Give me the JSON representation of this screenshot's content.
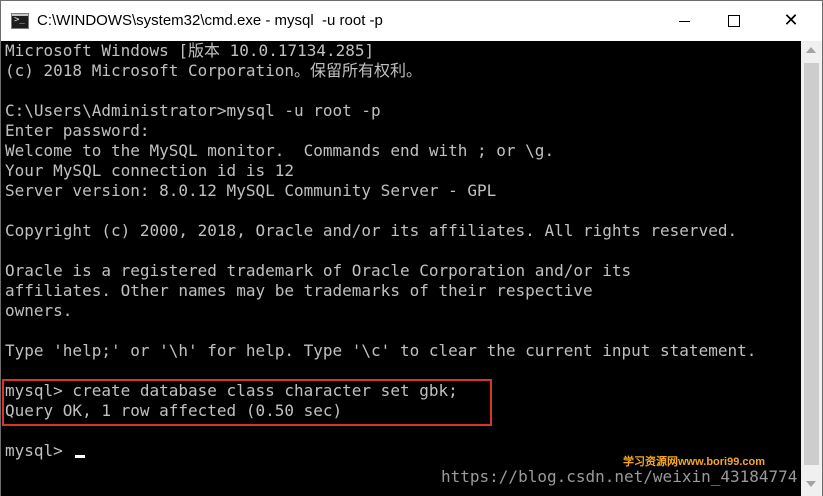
{
  "window": {
    "title": "C:\\WINDOWS\\system32\\cmd.exe - mysql  -u root -p"
  },
  "titlebar_icon": "cmd-icon",
  "controls": {
    "minimize_icon": "minimize-icon",
    "maximize_icon": "maximize-icon",
    "close_icon": "close-icon"
  },
  "console": {
    "lines": [
      "Microsoft Windows [版本 10.0.17134.285]",
      "(c) 2018 Microsoft Corporation。保留所有权利。",
      "",
      "C:\\Users\\Administrator>mysql -u root -p",
      "Enter password:",
      "Welcome to the MySQL monitor.  Commands end with ; or \\g.",
      "Your MySQL connection id is 12",
      "Server version: 8.0.12 MySQL Community Server - GPL",
      "",
      "Copyright (c) 2000, 2018, Oracle and/or its affiliates. All rights reserved.",
      "",
      "Oracle is a registered trademark of Oracle Corporation and/or its",
      "affiliates. Other names may be trademarks of their respective",
      "owners.",
      "",
      "Type 'help;' or '\\h' for help. Type '\\c' to clear the current input statement.",
      "",
      "mysql> create database class character set gbk;",
      "Query OK, 1 row affected (0.50 sec)",
      "",
      "mysql> "
    ]
  },
  "colors": {
    "console_bg": "#000000",
    "console_text": "#c0c0c0",
    "highlight": "#d9342b"
  },
  "watermark": {
    "url": "https://blog.csdn.net/weixin_43184774",
    "logo": "学习资源网www.bori99.com"
  }
}
